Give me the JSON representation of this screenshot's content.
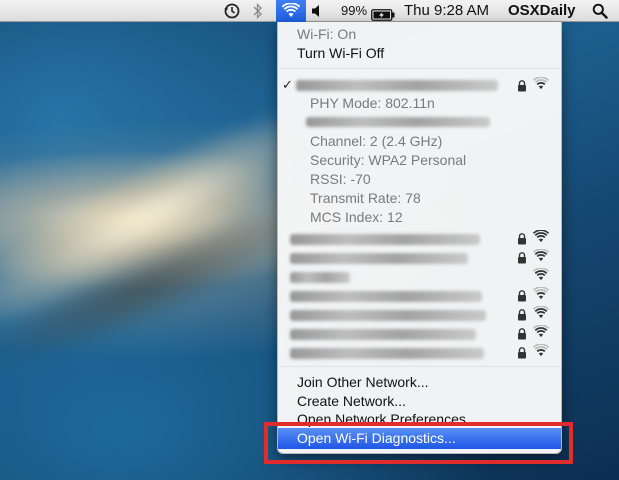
{
  "menubar": {
    "timemachine_icon": "time-machine-icon",
    "bluetooth_icon": "bluetooth-icon",
    "wifi_icon": "wifi-icon",
    "volume_icon": "volume-icon",
    "battery_percent": "99%",
    "battery_icon": "battery-charging-icon",
    "clock": "Thu 9:28 AM",
    "user": "OSXDaily",
    "spotlight_icon": "spotlight-search-icon",
    "wifi_active_color": "#2a6ae8"
  },
  "wifi_menu": {
    "status": "Wi-Fi: On",
    "toggle": "Turn Wi-Fi Off",
    "connected": {
      "phy_mode": "PHY Mode: 802.11n",
      "channel": "Channel: 2 (2.4 GHz)",
      "security": "Security: WPA2 Personal",
      "rssi": "RSSI: -70",
      "transmit_rate": "Transmit Rate: 78",
      "mcs_index": "MCS Index: 12"
    },
    "actions": {
      "join_other": "Join Other Network...",
      "create_network": "Create Network...",
      "open_prefs": "Open Network Preferences...",
      "open_diagnostics": "Open Wi-Fi Diagnostics..."
    },
    "highlight_color": "#1e56e6"
  },
  "annotation": {
    "highlight_box_color": "#e12c2c"
  }
}
